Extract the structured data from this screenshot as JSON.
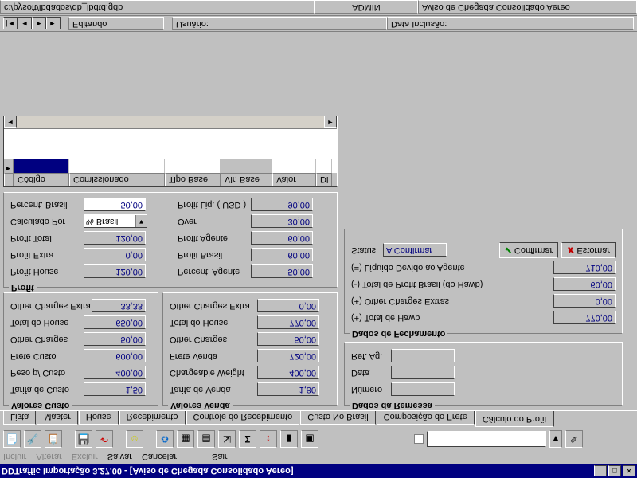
{
  "window": {
    "title": "DDTraffic Importação 3.27.00 - [Aviso de Chegada Consolidado Aereo]"
  },
  "menu": {
    "incluir": "Incluir",
    "alterar": "Alterar",
    "excluir": "Excluir",
    "salvar": "Salvar",
    "cancelar": "Cancelar",
    "sair": "Sair"
  },
  "tabs": [
    "Lista",
    "Master",
    "House",
    "Recebimento",
    "Controle do Recebimento",
    "Custo No Brasil",
    "Composição do Frete",
    "Cálculo do Profit"
  ],
  "active_tab": 7,
  "custo": {
    "title": "Valores Custo",
    "tarifa_lbl": "Tarifa de Custo",
    "tarifa": "1,50",
    "peso_lbl": "Peso p/ Custo",
    "peso": "400,00",
    "frete_lbl": "Frete Custo",
    "frete": "600,00",
    "other_lbl": "Other Charges",
    "other": "50,00",
    "total_lbl": "Total do House",
    "total": "650,00",
    "extra_lbl": "Other Charges Extra",
    "extra": "33,33"
  },
  "venda": {
    "title": "Valores Venda",
    "tarifa_lbl": "Tarifa de Venda",
    "tarifa": "1,80",
    "chg_lbl": "Chargeable Weight",
    "chg": "400,00",
    "frete_lbl": "Frete Venda",
    "frete": "720,00",
    "other_lbl": "Other Charges",
    "other": "50,00",
    "total_lbl": "Total do House",
    "total": "770,00",
    "extra_lbl": "Other Charges Extra",
    "extra": "0,00"
  },
  "profit": {
    "title": "Profit",
    "house_lbl": "Profit House",
    "house": "120,00",
    "extra_lbl": "Profit Extra",
    "extra": "0,00",
    "total_lbl": "Profit Total",
    "total": "120,00",
    "calc_lbl": "Calculado Por",
    "calc": "% Brasil",
    "pctbr_lbl": "Percent. Brasil",
    "pctbr": "50,00",
    "pctag_lbl": "Percent. Agente",
    "pctag": "50,00",
    "pbr_lbl": "Profit Brasil",
    "pbr": "60,00",
    "pag_lbl": "Profit Agente",
    "pag": "60,00",
    "over_lbl": "Over",
    "over": "30,00",
    "liq_lbl": "Profit Liq. ( USD )",
    "liq": "90,00"
  },
  "gridcols": [
    "Código",
    "Comissionado",
    "Tipo Base",
    "Vlr. Base",
    "Valor",
    "Di"
  ],
  "remessa": {
    "title": "Dados da Remessa",
    "num_lbl": "Número",
    "data_lbl": "Data",
    "ref_lbl": "Ref. Ag."
  },
  "fechamento": {
    "title": "Dados de Fechamento",
    "tothawb_lbl": "(+) Total de Hawb",
    "tothawb": "770,00",
    "extras_lbl": "(+) Other Charges Extras",
    "extras": "0,00",
    "pbr_lbl": "(-) Total de Profit Brasil (do Hawb)",
    "pbr": "60,00",
    "liq_lbl": "(=) Líquido Devido ao Agente",
    "liq": "710,00",
    "status_lbl": "Status",
    "status": "A Confirmar",
    "confirm_btn": "Confirmar",
    "estorn_btn": "Estornar"
  },
  "statusbar": {
    "edit": "Editando",
    "usuario_lbl": "Usuário:",
    "data_incl_lbl": "Data Inclusão:",
    "path": "c:/pysoft/ibdados/db_ibdtd.gdb",
    "user": "ADMIN",
    "module": "Aviso de Chegada Consolidado Aereo"
  }
}
